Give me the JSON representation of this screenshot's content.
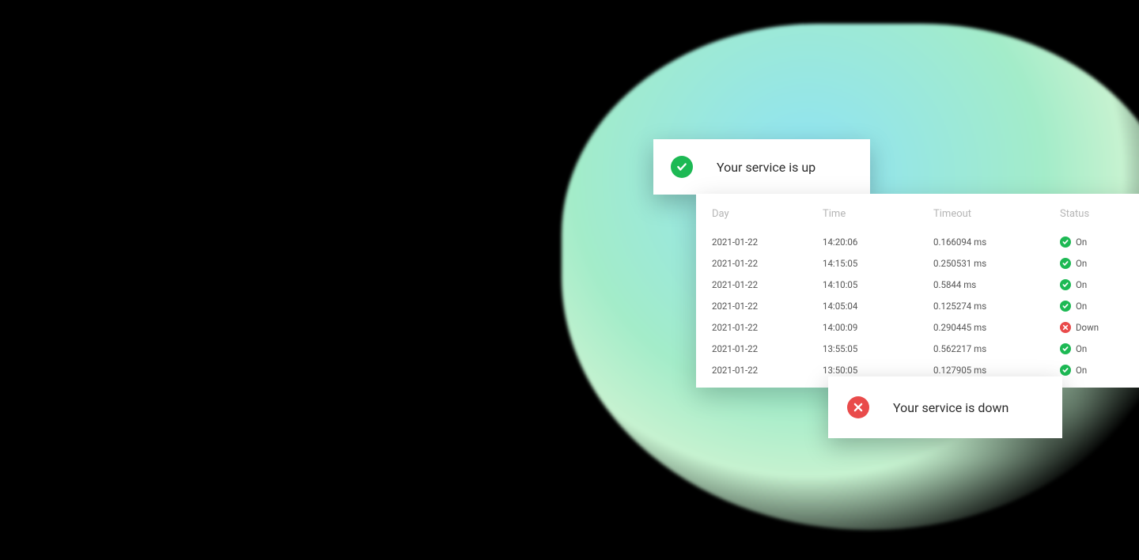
{
  "banner_up": {
    "title": "Your service is up",
    "icon": "check"
  },
  "banner_down": {
    "title": "Your service is down",
    "icon": "cross"
  },
  "colors": {
    "green": "#1db954",
    "red": "#e94b4b"
  },
  "log": {
    "headers": {
      "day": "Day",
      "time": "Time",
      "timeout": "Timeout",
      "status": "Status"
    },
    "status_labels": {
      "on": "On",
      "down": "Down"
    },
    "rows": [
      {
        "day": "2021-01-22",
        "time": "14:20:06",
        "timeout": "0.166094 ms",
        "status": "on"
      },
      {
        "day": "2021-01-22",
        "time": "14:15:05",
        "timeout": "0.250531 ms",
        "status": "on"
      },
      {
        "day": "2021-01-22",
        "time": "14:10:05",
        "timeout": "0.5844 ms",
        "status": "on"
      },
      {
        "day": "2021-01-22",
        "time": "14:05:04",
        "timeout": "0.125274 ms",
        "status": "on"
      },
      {
        "day": "2021-01-22",
        "time": "14:00:09",
        "timeout": "0.290445 ms",
        "status": "down"
      },
      {
        "day": "2021-01-22",
        "time": "13:55:05",
        "timeout": "0.562217 ms",
        "status": "on"
      },
      {
        "day": "2021-01-22",
        "time": "13:50:05",
        "timeout": "0.127905 ms",
        "status": "on"
      }
    ]
  }
}
